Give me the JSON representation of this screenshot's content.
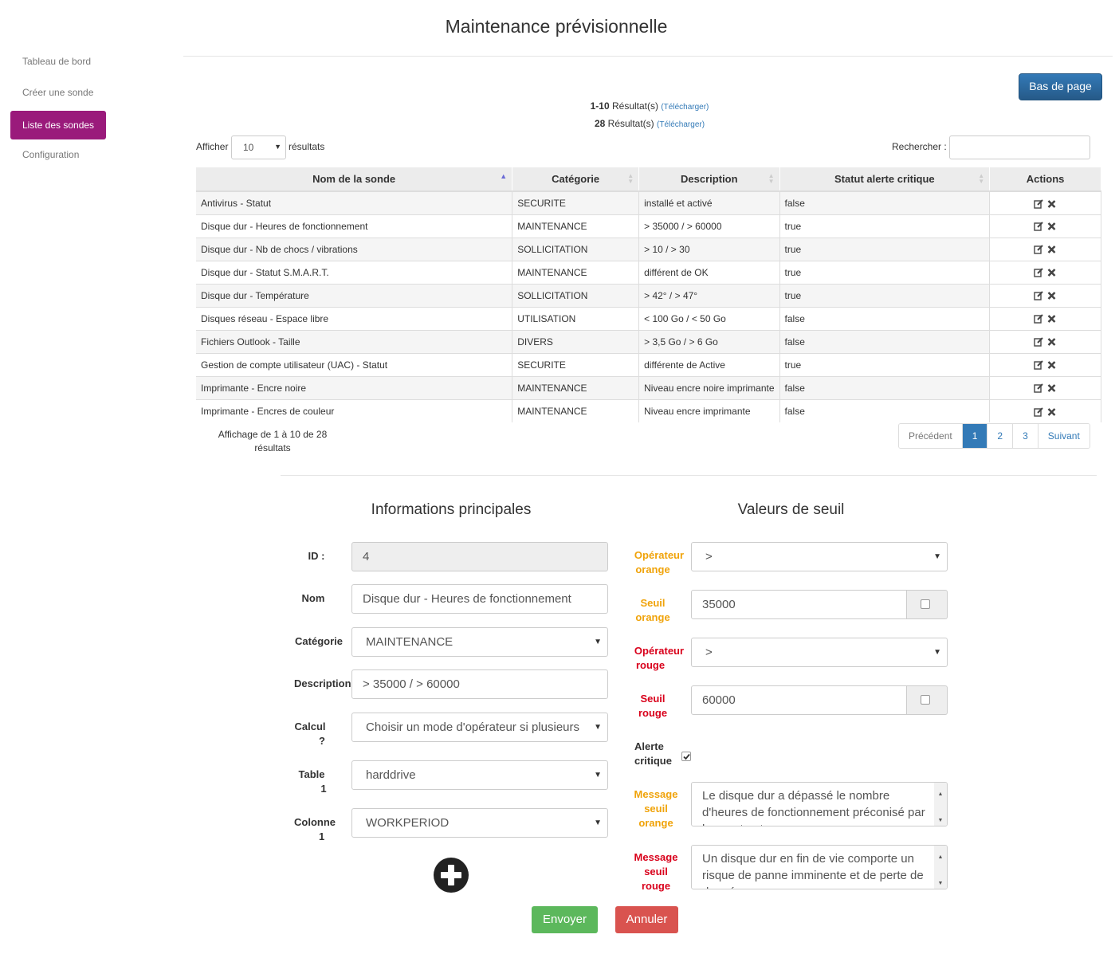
{
  "page": {
    "title": "Maintenance prévisionnelle"
  },
  "sidebar": {
    "items": [
      {
        "label": "Tableau de bord"
      },
      {
        "label": "Créer une sonde"
      },
      {
        "label": "Liste des sondes",
        "active": true
      },
      {
        "label": "Configuration"
      }
    ]
  },
  "toolbar": {
    "bottom_button": "Bas de page"
  },
  "results": {
    "range": "1-10",
    "range_suffix": "Résultat(s)",
    "total": "28",
    "total_suffix": "Résultat(s)",
    "download": "(Télécharger)"
  },
  "list_controls": {
    "show_label": "Afficher",
    "page_size": "10",
    "results_label": "résultats",
    "search_label": "Rechercher :",
    "search_value": ""
  },
  "table": {
    "columns": [
      "Nom de la sonde",
      "Catégorie",
      "Description",
      "Statut alerte critique",
      "Actions"
    ],
    "rows": [
      [
        "Antivirus - Statut",
        "SECURITE",
        "installé et activé",
        "false"
      ],
      [
        "Disque dur - Heures de fonctionnement",
        "MAINTENANCE",
        "> 35000 / > 60000",
        "true"
      ],
      [
        "Disque dur - Nb de chocs / vibrations",
        "SOLLICITATION",
        "> 10 / > 30",
        "true"
      ],
      [
        "Disque dur - Statut S.M.A.R.T.",
        "MAINTENANCE",
        "différent de OK",
        "true"
      ],
      [
        "Disque dur - Température",
        "SOLLICITATION",
        "> 42° / > 47°",
        "true"
      ],
      [
        "Disques réseau - Espace libre",
        "UTILISATION",
        "< 100 Go / < 50 Go",
        "false"
      ],
      [
        "Fichiers Outlook - Taille",
        "DIVERS",
        "> 3,5 Go / > 6 Go",
        "false"
      ],
      [
        "Gestion de compte utilisateur (UAC) - Statut",
        "SECURITE",
        "différente de Active",
        "true"
      ],
      [
        "Imprimante - Encre noire",
        "MAINTENANCE",
        "Niveau encre noire imprimante",
        "false"
      ],
      [
        "Imprimante - Encres de couleur",
        "MAINTENANCE",
        "Niveau encre imprimante",
        "false"
      ]
    ],
    "info_line1": "Affichage de 1 à 10 de 28",
    "info_line2": "résultats"
  },
  "pagination": {
    "prev": "Précédent",
    "pages": [
      "1",
      "2",
      "3"
    ],
    "current": "1",
    "next": "Suivant"
  },
  "form": {
    "main_title": "Informations principales",
    "threshold_title": "Valeurs de seuil",
    "id": {
      "label": "ID :",
      "value": "4"
    },
    "nom": {
      "label": "Nom",
      "value": "Disque dur - Heures de fonctionnement"
    },
    "categorie": {
      "label": "Catégorie",
      "value": "MAINTENANCE"
    },
    "description": {
      "label": "Description",
      "value": "> 35000 / > 60000"
    },
    "calcul": {
      "label1": "Calcul",
      "label2": "?",
      "value": "Choisir un mode d'opérateur si plusieurs"
    },
    "table1": {
      "label1": "Table",
      "label2": "1",
      "value": "harddrive"
    },
    "colonne1": {
      "label1": "Colonne",
      "label2": "1",
      "value": "WORKPERIOD"
    },
    "op_orange": {
      "label1": "Opérateur",
      "label2": "orange",
      "value": ">"
    },
    "seuil_orange": {
      "label1": "Seuil",
      "label2": "orange",
      "value": "35000",
      "checked": false
    },
    "op_rouge": {
      "label1": "Opérateur",
      "label2": "rouge",
      "value": ">"
    },
    "seuil_rouge": {
      "label1": "Seuil",
      "label2": "rouge",
      "value": "60000",
      "checked": false
    },
    "alerte": {
      "label1": "Alerte",
      "label2": "critique",
      "checked": true
    },
    "msg_orange": {
      "label1": "Message",
      "label2": "seuil",
      "label3": "orange",
      "value": "Le disque dur a dépassé le nombre d'heures de fonctionnement préconisé par le constructeur."
    },
    "msg_rouge": {
      "label1": "Message",
      "label2": "seuil",
      "label3": "rouge",
      "value": "Un disque dur en fin de vie comporte un risque de panne imminente et de perte de données."
    }
  },
  "buttons": {
    "send": "Envoyer",
    "cancel": "Annuler"
  },
  "colors": {
    "sidebar_active": "#9a1a7b",
    "primary": "#337ab7",
    "success": "#5cb85c",
    "danger": "#d9534f",
    "orange": "#f0a30a",
    "red": "#d9001b"
  }
}
